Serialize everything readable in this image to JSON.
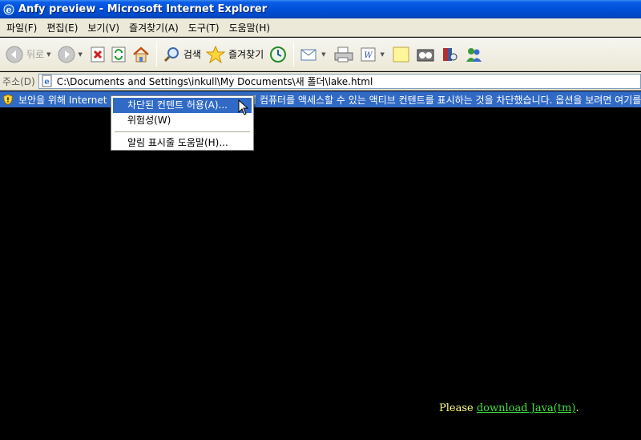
{
  "window": {
    "title": "Anfy preview - Microsoft Internet Explorer"
  },
  "menubar": {
    "items": [
      {
        "label": "파일(F)"
      },
      {
        "label": "편집(E)"
      },
      {
        "label": "보기(V)"
      },
      {
        "label": "즐겨찾기(A)"
      },
      {
        "label": "도구(T)"
      },
      {
        "label": "도움말(H)"
      }
    ]
  },
  "toolbar": {
    "back_label": "뒤로",
    "search_label": "검색",
    "favorites_label": "즐겨찾기",
    "icons": [
      "back-icon",
      "forward-icon",
      "stop-icon",
      "refresh-icon",
      "home-icon",
      "search-icon",
      "favorites-icon",
      "history-icon",
      "mail-icon",
      "print-icon",
      "edit-icon",
      "discuss-icon",
      "media-icon",
      "research-icon",
      "messenger-icon"
    ]
  },
  "address": {
    "label": "주소(D)",
    "url": "C:\\Documents and Settings\\inkull\\My Documents\\새 폴더\\lake.html"
  },
  "infobar": {
    "text": "보안을 위해 Internet Explorer에서 이 파일에서 사용자의 컴퓨터를 액세스할 수 있는 액티브 컨텐트를 표시하는 것을 차단했습니다. 옵션을 보려면 여기를 클릭하십시오..."
  },
  "context_menu": {
    "items": [
      {
        "label": "차단된 컨텐트 허용(A)...",
        "selected": true
      },
      {
        "label": "위험성(W)",
        "selected": false
      },
      {
        "label": "알림 표시줄 도움말(H)...",
        "selected": false
      }
    ]
  },
  "content": {
    "prefix": "Please ",
    "link": "download Java(tm)",
    "suffix": "."
  },
  "colors": {
    "titlebar": "#0050d8",
    "infobar": "#316ac5",
    "page_background": "#000000",
    "message_text": "#ffff80",
    "link": "#40e040"
  }
}
